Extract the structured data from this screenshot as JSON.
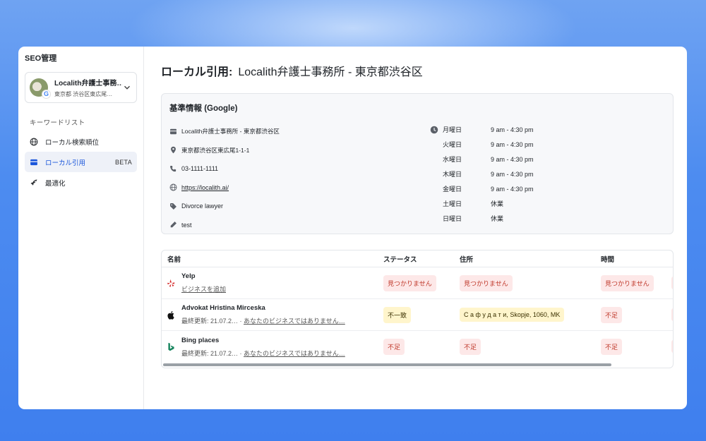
{
  "sidebar": {
    "app_title": "SEO管理",
    "business": {
      "name": "Localith弁護士事務…",
      "address": "東京都 渋谷区東広尾…",
      "badge_letter": "G"
    },
    "section_label": "キーワードリスト",
    "items": [
      {
        "label": "ローカル検索順位",
        "icon": "globe-icon"
      },
      {
        "label": "ローカル引用",
        "icon": "store-icon",
        "badge": "BETA",
        "active": true
      },
      {
        "label": "最適化",
        "icon": "rocket-icon"
      }
    ]
  },
  "main": {
    "title_prefix": "ローカル引用:",
    "title_business": "Localith弁護士事務所 - 東京都渋谷区",
    "info_card": {
      "title": "基準情報 (Google)",
      "name": "Localith弁護士事務所 - 東京都渋谷区",
      "address": "東京都渋谷区東広尾1-1-1",
      "phone": "03-1111-1111",
      "website": "https://localith.ai/",
      "category": "Divorce lawyer",
      "note": "test",
      "hours": [
        {
          "day": "月曜日",
          "time": "9 am - 4:30 pm"
        },
        {
          "day": "火曜日",
          "time": "9 am - 4:30 pm"
        },
        {
          "day": "水曜日",
          "time": "9 am - 4:30 pm"
        },
        {
          "day": "木曜日",
          "time": "9 am - 4:30 pm"
        },
        {
          "day": "金曜日",
          "time": "9 am - 4:30 pm"
        },
        {
          "day": "土曜日",
          "time": "休業"
        },
        {
          "day": "日曜日",
          "time": "休業"
        }
      ]
    },
    "table": {
      "headers": [
        "名前",
        "ステータス",
        "住所",
        "時間"
      ],
      "rows": [
        {
          "name": "Yelp",
          "sub_link": "ビジネスを追加",
          "status": "見つかりません",
          "address": "見つかりません",
          "hours": "見つかりません"
        },
        {
          "name": "Advokat Hristina Mirceska",
          "updated": "最終更新: 21.07.2…",
          "sub_link": "あなたのビジネスではありません…",
          "status": "不一致",
          "address": "С а ф у д а т и, Skopje, 1060, MK",
          "hours": "不足"
        },
        {
          "name": "Bing places",
          "updated": "最終更新: 21.07.2…",
          "sub_link": "あなたのビジネスではありません…",
          "status": "不足",
          "address": "不足",
          "hours": "不足"
        }
      ]
    }
  },
  "colors": {
    "background": "#4d8cf0",
    "badge_red_bg": "#fde8e8",
    "badge_red_text": "#c0392b",
    "badge_yellow_bg": "#fff5cc",
    "active_nav_bg": "#eef1f8"
  }
}
